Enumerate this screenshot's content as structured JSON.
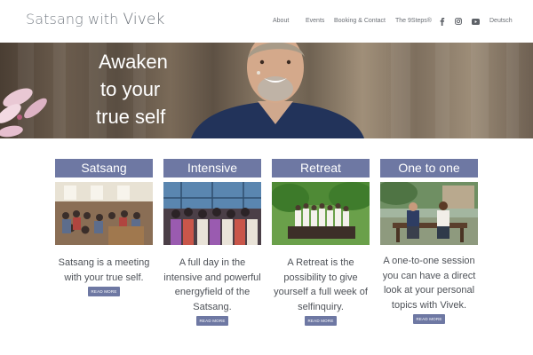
{
  "brand": {
    "name_light": "Satsang with ",
    "name_strong": "Vivek"
  },
  "nav": {
    "items": [
      {
        "label": "About"
      },
      {
        "label": "Events"
      },
      {
        "label": "Booking & Contact"
      },
      {
        "label": "The 9Steps®"
      }
    ],
    "social_icons": [
      "facebook-icon",
      "instagram-icon",
      "youtube-icon"
    ],
    "language": "Deutsch"
  },
  "hero": {
    "lines": [
      "Awaken",
      "to your",
      "true self"
    ]
  },
  "cards": [
    {
      "title": "Satsang",
      "text": "Satsang is a meeting with your true self.",
      "button": "READ MORE"
    },
    {
      "title": "Intensive",
      "text": "A full day in the intensive and powerful energyfield of the Satsang.",
      "button": "READ MORE"
    },
    {
      "title": "Retreat",
      "text": "A Retreat is the possibility to give yourself a full week of selfinquiry.",
      "button": "READ MORE"
    },
    {
      "title": "One to one",
      "text": "A one-to-one session you can have a direct look at your personal topics with Vivek.",
      "button": "READ MORE"
    }
  ],
  "colors": {
    "accent": "#6e78a3",
    "text": "#4e5258",
    "nav_text": "#6b6f75"
  }
}
